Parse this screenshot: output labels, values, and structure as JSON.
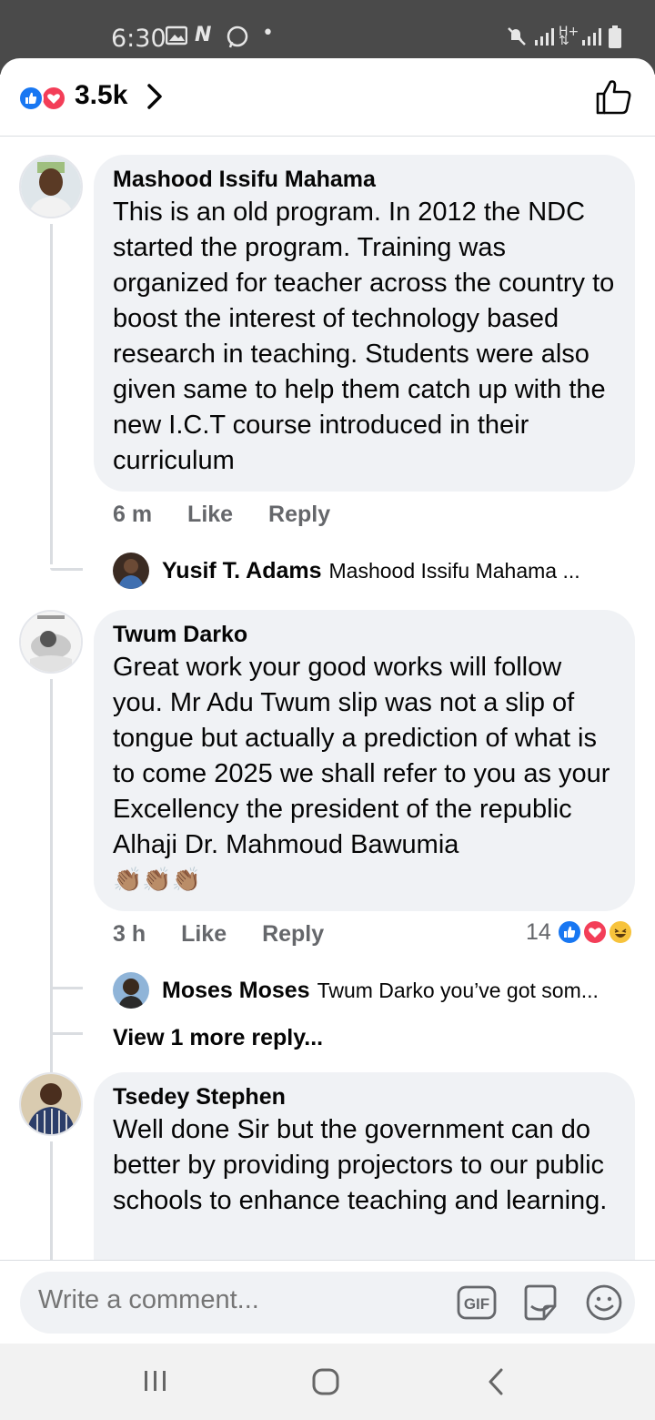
{
  "status_bar": {
    "time": "6:30",
    "icons": [
      "gallery-icon",
      "n-icon",
      "whatsapp-icon",
      "dot-icon",
      "mute-icon",
      "signal-icon",
      "data-icon",
      "signal-icon",
      "battery-icon"
    ]
  },
  "header": {
    "reaction_count": "3.5k",
    "reaction_icons": [
      "like-reaction-icon",
      "love-reaction-icon"
    ],
    "accent_like": "#1877f2",
    "accent_love": "#f33e58"
  },
  "comments": [
    {
      "author": "Mashood Issifu Mahama",
      "text": "This is an old program. In 2012 the NDC started the program. Training was organized for teacher across the country to boost the interest of technology based research in teaching. Students were also given same to help them catch up with the new I.C.T course introduced in their curriculum",
      "time": "6 m",
      "like": "Like",
      "reply": "Reply",
      "replies": [
        {
          "author": "Yusif T. Adams",
          "text": "Mashood Issifu Mahama ..."
        }
      ]
    },
    {
      "author": "Twum Darko",
      "text": "Great work your good works will follow you. Mr Adu Twum slip was not a slip of tongue but actually a prediction of what is to come 2025 we shall refer to you as your Excellency the president of the republic Alhaji Dr. Mahmoud Bawumia",
      "emoji": "👏🏽👏🏽👏🏽",
      "time": "3 h",
      "like": "Like",
      "reply": "Reply",
      "reaction_count": "14",
      "replies": [
        {
          "author": "Moses Moses",
          "text": "Twum Darko  you’ve got som..."
        }
      ],
      "view_more": "View 1 more reply..."
    },
    {
      "author": "Tsedey Stephen",
      "text": "Well done Sir but the government can do better by providing projectors to our public schools to enhance teaching and learning."
    }
  ],
  "composer": {
    "placeholder": "Write a comment...",
    "gif_label": "GIF"
  }
}
